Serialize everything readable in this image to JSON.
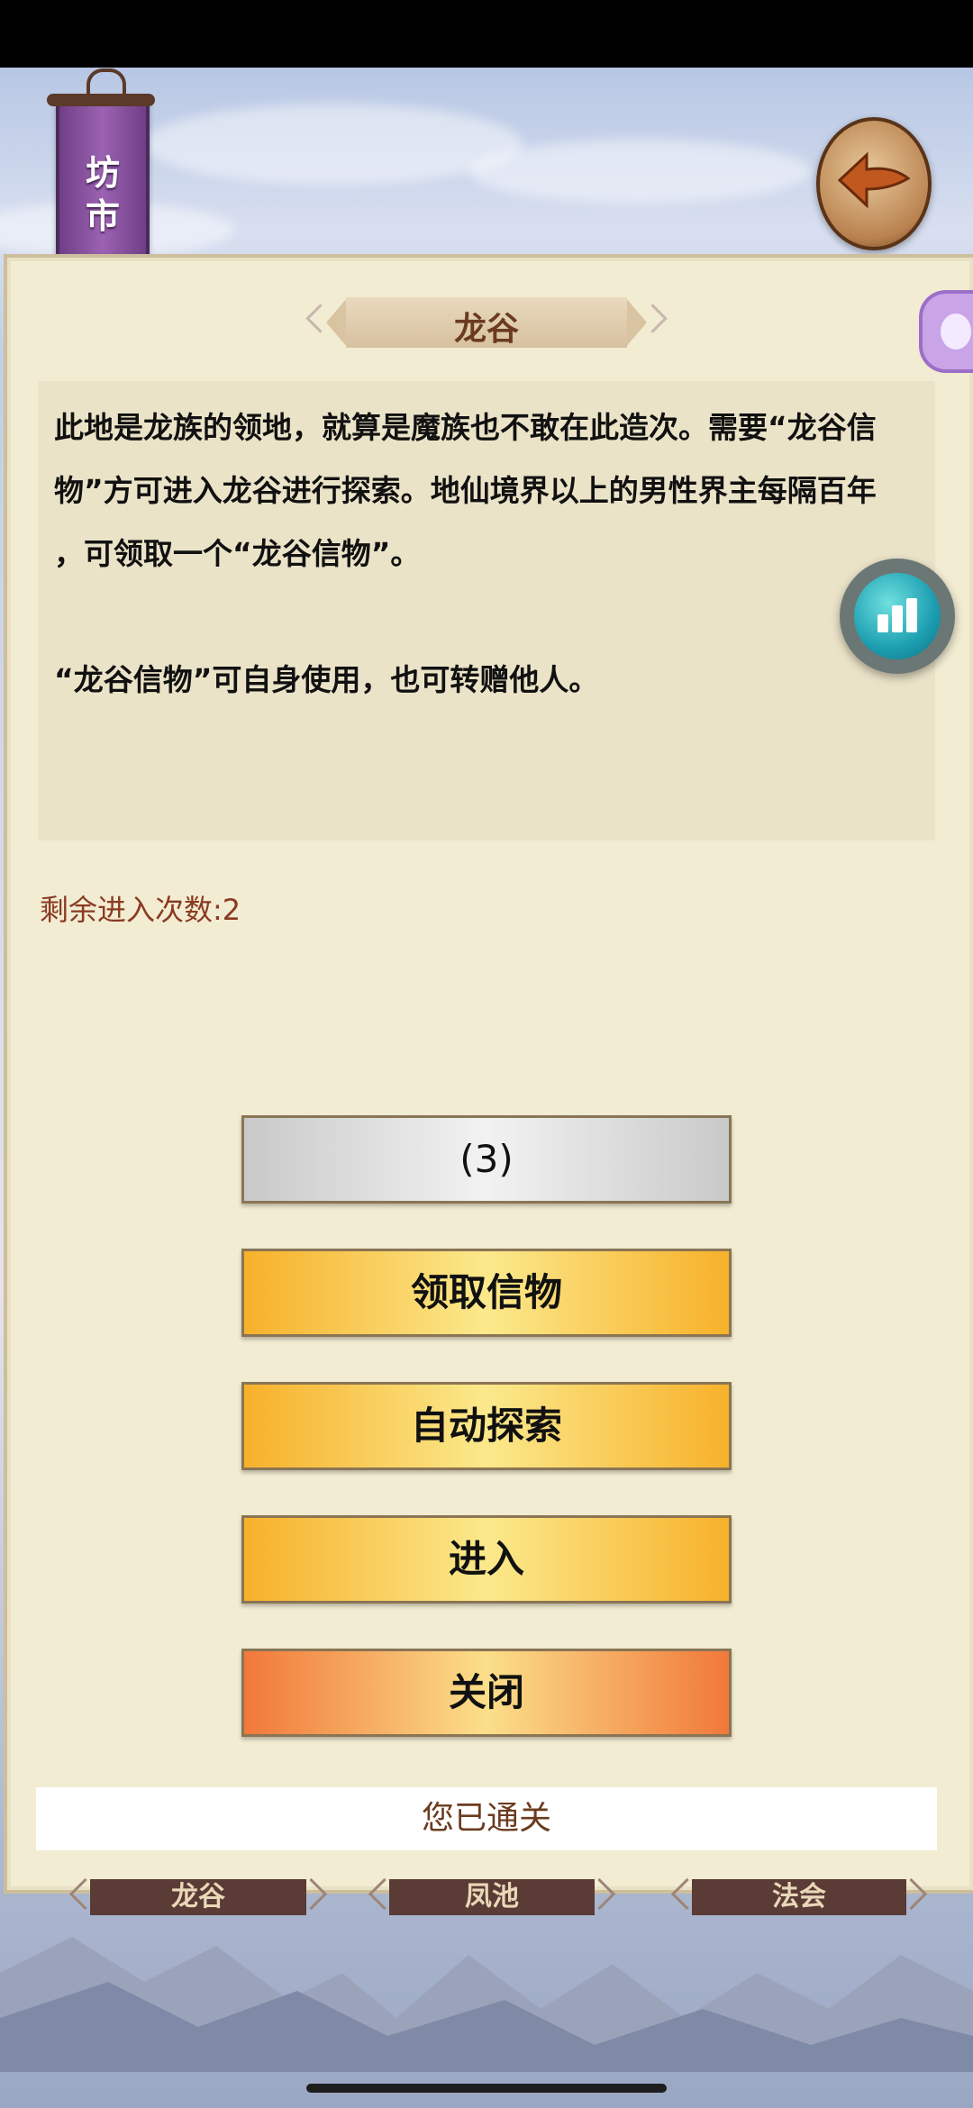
{
  "banner": {
    "line1": "坊",
    "line2": "市"
  },
  "panel": {
    "title": "龙谷",
    "description": [
      "此地是龙族的领地，就算是魔族也不敢在此造次。需要“龙谷信",
      "物”方可进入龙谷进行探索。地仙境界以上的男性界主每隔百年",
      "，可领取一个“龙谷信物”。",
      "“龙谷信物”可自身使用，也可转赠他人。"
    ],
    "remaining_label": "剩余进入次数:",
    "remaining_count": "2",
    "countdown_button": "(3)",
    "claim_button": "领取信物",
    "auto_explore_button": "自动探索",
    "enter_button": "进入",
    "close_button": "关闭",
    "notice": "您已通关"
  },
  "bottom_tabs": [
    "龙谷",
    "凤池",
    "法会"
  ],
  "colors": {
    "title_brown": "#6b3b1f",
    "remaining_red": "#8a3a22",
    "gold": "#f7b12a",
    "orange": "#f1783a"
  }
}
